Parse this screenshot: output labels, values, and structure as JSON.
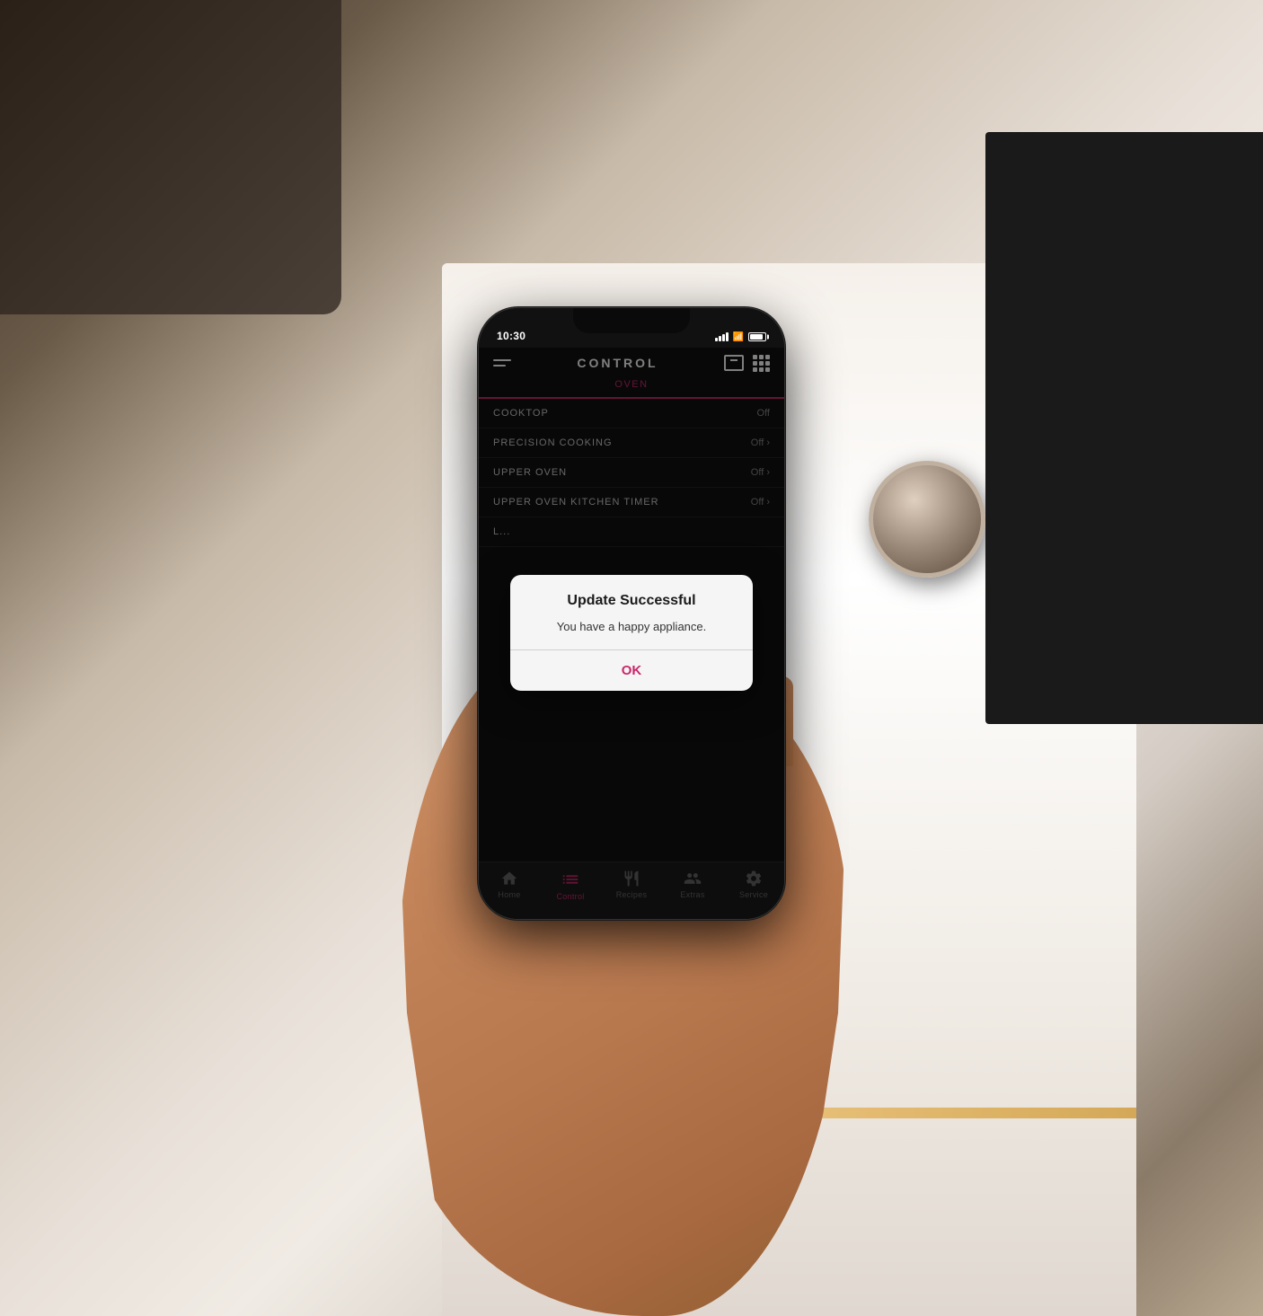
{
  "background": {
    "scene": "kitchen with white oven"
  },
  "phone": {
    "status_bar": {
      "time": "10:30",
      "signal_label": "signal",
      "wifi_label": "wifi",
      "battery_label": "battery"
    },
    "header": {
      "menu_icon": "hamburger-menu",
      "title": "CONTROL",
      "grid_icon": "grid-icon"
    },
    "tabs": [
      {
        "label": "OVEN",
        "active": true
      }
    ],
    "menu_items": [
      {
        "label": "COOKTOP",
        "value": "Off",
        "has_arrow": false
      },
      {
        "label": "PRECISION COOKING",
        "value": "Off",
        "has_arrow": true
      },
      {
        "label": "UPPER OVEN",
        "value": "Off",
        "has_arrow": true
      },
      {
        "label": "UPPER OVEN KITCHEN TIMER",
        "value": "Off",
        "has_arrow": true
      },
      {
        "label": "L...",
        "value": "",
        "has_arrow": false
      }
    ],
    "dialog": {
      "title": "Update Successful",
      "message": "You have a happy appliance.",
      "ok_button": "OK"
    },
    "bottom_nav": [
      {
        "label": "Home",
        "icon": "home",
        "active": false
      },
      {
        "label": "Control",
        "icon": "control",
        "active": true
      },
      {
        "label": "Recipes",
        "icon": "recipes",
        "active": false
      },
      {
        "label": "Extras",
        "icon": "extras",
        "active": false
      },
      {
        "label": "Service",
        "icon": "service",
        "active": false
      }
    ]
  },
  "colors": {
    "accent": "#c8286a",
    "background": "#111111",
    "dialog_bg": "#f5f5f5",
    "text_primary": "#ffffff",
    "text_secondary": "#888888"
  }
}
